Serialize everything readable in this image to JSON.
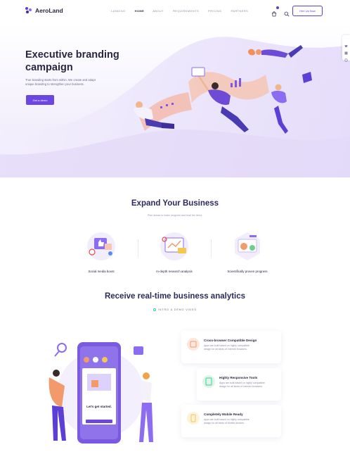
{
  "brand": {
    "name": "AeroLand",
    "accent": "#5b3fd6"
  },
  "nav": {
    "items": [
      "LANDING",
      "HOME",
      "ABOUT",
      "REQUIREMENTS",
      "PRICING",
      "PARTNERS"
    ],
    "active": "HOME"
  },
  "header": {
    "cart_icon": "cart-icon",
    "search_icon": "search-icon",
    "cta": "Hire Us Now"
  },
  "hero": {
    "title_line1": "Executive branding",
    "title_line2": "campaign",
    "subtitle_line1": "True branding starts from within. We create and adapt",
    "subtitle_line2": "unique branding to strengthen your business.",
    "cta": "Get a demo"
  },
  "expand": {
    "title": "Expand Your Business",
    "subtitle": "Plan ahead to make progress and lead the trend.",
    "features": [
      {
        "label": "Social media boost"
      },
      {
        "label": "In-depth research analysis"
      },
      {
        "label": "Scientifically proven progress"
      }
    ]
  },
  "analytics": {
    "title": "Receive real-time business analytics",
    "tag": "INTRO & DEMO VIDEO",
    "phone_greeting": "Let's get started.",
    "cards": [
      {
        "title": "Cross-browser Compatible Design",
        "text": "Apps are built based on highly compatible design for all kinds of Internet browsers."
      },
      {
        "title": "Highly Responsive Tools",
        "text": "Apps are built based on highly compatible design for all kinds of Internet browsers."
      },
      {
        "title": "Completely Mobile Ready",
        "text": "Apps are built based on highly compatible design for all kinds of Mobile devices."
      }
    ]
  }
}
